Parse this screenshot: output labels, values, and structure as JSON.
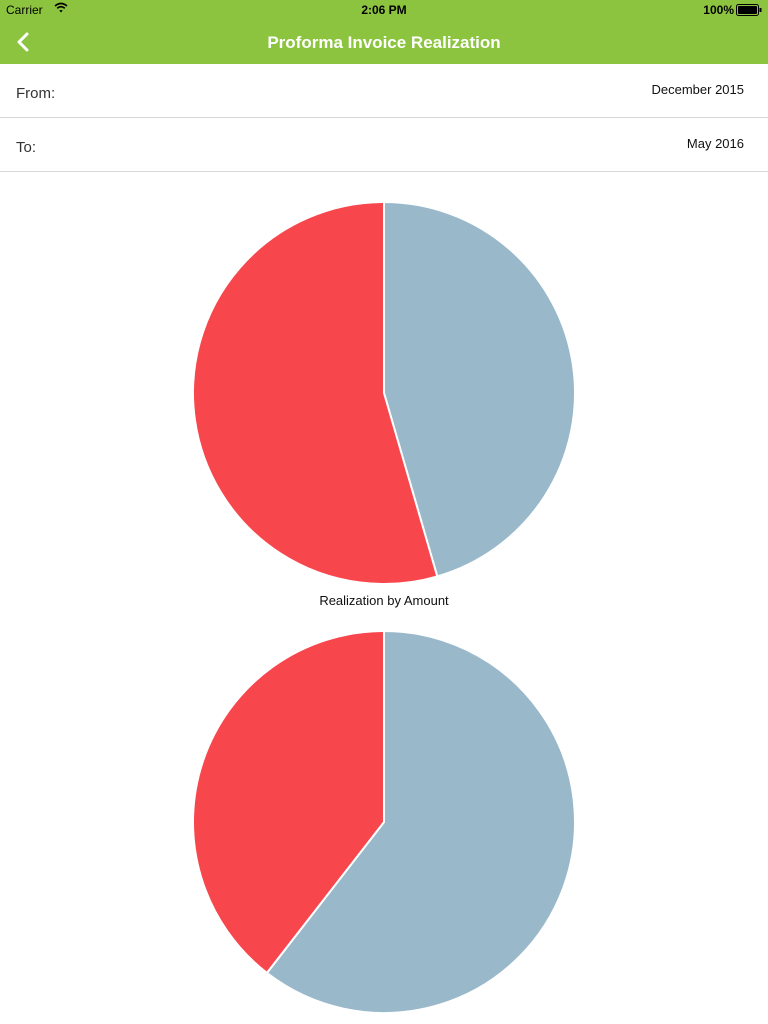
{
  "status_bar": {
    "carrier": "Carrier",
    "time": "2:06 PM",
    "battery": "100%"
  },
  "nav": {
    "title": "Proforma Invoice Realization",
    "back_icon": "chevron-left-icon"
  },
  "filters": {
    "from_label": "From:",
    "from_value": "December 2015",
    "to_label": "To:",
    "to_value": "May 2016"
  },
  "colors": {
    "brand": "#8dc43f",
    "red": "#f8464d",
    "blue": "#99b9cb"
  },
  "chart_data": [
    {
      "type": "pie",
      "title": "",
      "slices": [
        {
          "value": 45.5,
          "color": "#99b9cb"
        },
        {
          "value": 54.5,
          "color": "#f8464d"
        }
      ]
    },
    {
      "type": "pie",
      "title": "Realization by Amount",
      "slices": [
        {
          "value": 60.5,
          "color": "#99b9cb"
        },
        {
          "value": 39.5,
          "color": "#f8464d"
        }
      ]
    }
  ]
}
